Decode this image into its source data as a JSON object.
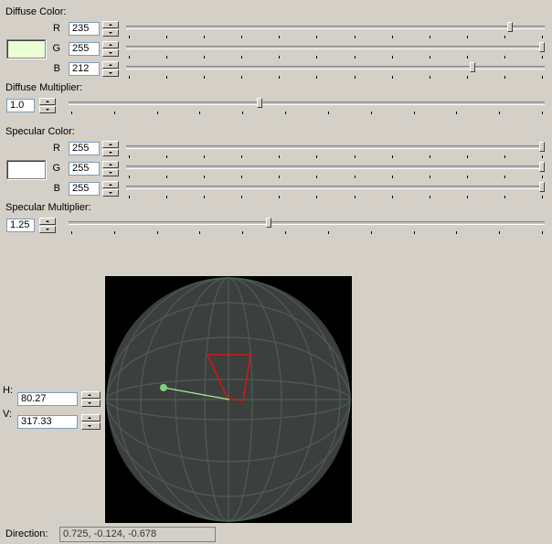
{
  "diffuse": {
    "title": "Diffuse Color:",
    "swatch_color": "#ebffd4",
    "channels": [
      {
        "label": "R",
        "value": "235",
        "level": 0.922
      },
      {
        "label": "G",
        "value": "255",
        "level": 1.0
      },
      {
        "label": "B",
        "value": "212",
        "level": 0.831
      }
    ]
  },
  "diffuse_multiplier": {
    "title": "Diffuse Multiplier:",
    "value": "1.0",
    "level": 0.4
  },
  "specular": {
    "title": "Specular Color:",
    "swatch_color": "#ffffff",
    "channels": [
      {
        "label": "R",
        "value": "255",
        "level": 1.0
      },
      {
        "label": "G",
        "value": "255",
        "level": 1.0
      },
      {
        "label": "B",
        "value": "255",
        "level": 1.0
      }
    ]
  },
  "specular_multiplier": {
    "title": "Specular Multiplier:",
    "value": "1.25",
    "level": 0.42
  },
  "light_direction": {
    "h_label": "H:",
    "h_value": "80.27",
    "v_label": "V:",
    "v_value": "317.33",
    "direction_label": "Direction:",
    "direction_value": "0.725, -0.124, -0.678"
  },
  "colors": {
    "sphere_fill": "#3c3f3d",
    "sphere_grid": "#4a5a52",
    "light_line": "#a8e8a0",
    "light_dot": "#7ed07e",
    "frustum": "#d01818"
  }
}
